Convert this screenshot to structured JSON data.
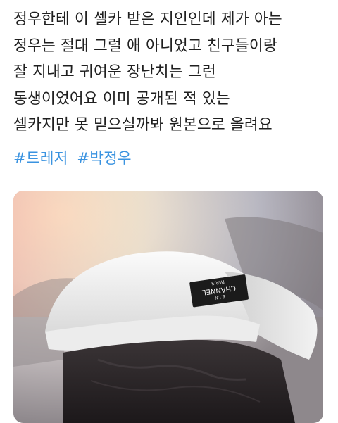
{
  "tweet": {
    "lines": [
      "정우한테 이 셀카 받은 지인인데 제가 아는",
      "정우는 절대 그럴 애 아니었고 친구들이랑",
      "잘 지내고 귀여운 장난치는 그런",
      "동생이었어요 이미 공개된 적 있는",
      "셀카지만 못 믿으실까봐 원본으로 올려요"
    ],
    "hashtags": [
      "#트레저",
      "#박정우"
    ]
  },
  "media": {
    "cap_label_lines": [
      "E.I.N",
      "CHANNEL",
      "PARIS"
    ]
  }
}
